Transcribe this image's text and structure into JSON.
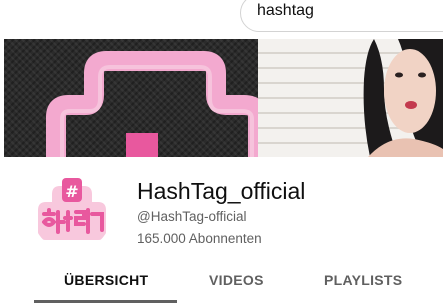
{
  "search": {
    "value": "hashtag"
  },
  "channel": {
    "title": "HashTag_official",
    "handle": "@HashTag-official",
    "subscribers": "165.000 Abonnenten",
    "brand_colors": {
      "pink_light": "#f3a9cf",
      "pink": "#e8589e"
    }
  },
  "tabs": [
    {
      "label": "ÜBERSICHT",
      "active": true
    },
    {
      "label": "VIDEOS",
      "active": false
    },
    {
      "label": "PLAYLISTS",
      "active": false
    }
  ]
}
